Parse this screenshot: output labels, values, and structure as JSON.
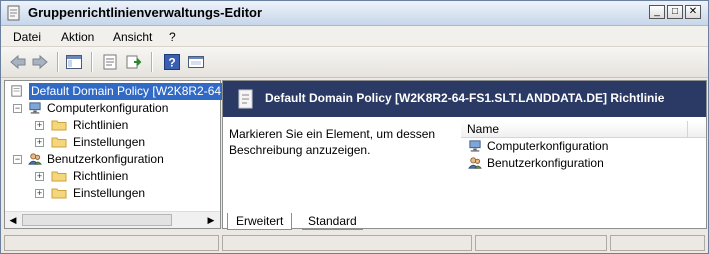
{
  "window": {
    "title": "Gruppenrichtlinienverwaltungs-Editor"
  },
  "menu": [
    "Datei",
    "Aktion",
    "Ansicht",
    "?"
  ],
  "tree": {
    "root": "Default Domain Policy [W2K8R2-64",
    "computer": "Computerkonfiguration",
    "computer_policies": "Richtlinien",
    "computer_settings": "Einstellungen",
    "user": "Benutzerkonfiguration",
    "user_policies": "Richtlinien",
    "user_settings": "Einstellungen"
  },
  "details": {
    "header_title": "Default Domain Policy [W2K8R2-64-FS1.SLT.LANDDATA.DE] Richtlinie",
    "description": "Markieren Sie ein Element, um dessen Beschreibung anzuzeigen.",
    "column_name": "Name",
    "items": [
      "Computerkonfiguration",
      "Benutzerkonfiguration"
    ]
  },
  "tabs": [
    "Erweitert",
    "Standard"
  ]
}
